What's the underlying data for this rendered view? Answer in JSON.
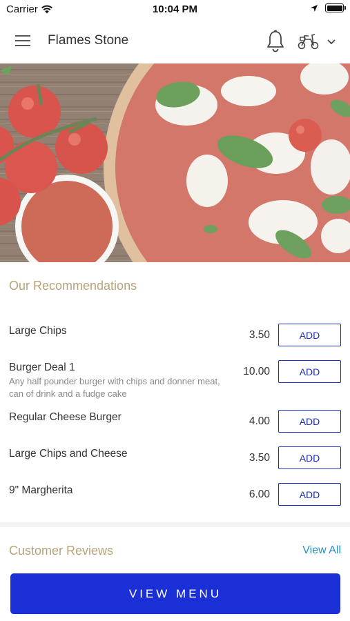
{
  "status_bar": {
    "carrier": "Carrier",
    "time": "10:04 PM"
  },
  "header": {
    "title": "Flames Stone",
    "icons": [
      "menu-icon",
      "bell-icon",
      "scooter-icon",
      "chevron-down-icon"
    ]
  },
  "hero": {
    "image": "pizza-margherita-with-tomatoes-and-sauce"
  },
  "recommendations": {
    "title": "Our Recommendations",
    "add_label": "ADD",
    "items": [
      {
        "name": "Large Chips",
        "price": "3.50",
        "description": ""
      },
      {
        "name": "Burger Deal 1",
        "price": "10.00",
        "description": "Any half pounder burger with chips and donner meat, can of drink and a fudge cake"
      },
      {
        "name": "Regular Cheese Burger",
        "price": "4.00",
        "description": ""
      },
      {
        "name": "Large Chips and Cheese",
        "price": "3.50",
        "description": ""
      },
      {
        "name": "9\" Margherita",
        "price": "6.00",
        "description": ""
      }
    ]
  },
  "reviews": {
    "title": "Customer Reviews",
    "view_all": "View All"
  },
  "footer": {
    "view_menu": "VIEW MENU"
  },
  "colors": {
    "accent_gold": "#b7a27c",
    "primary_blue": "#1a2fd6",
    "link_blue": "#2a8fc4"
  }
}
